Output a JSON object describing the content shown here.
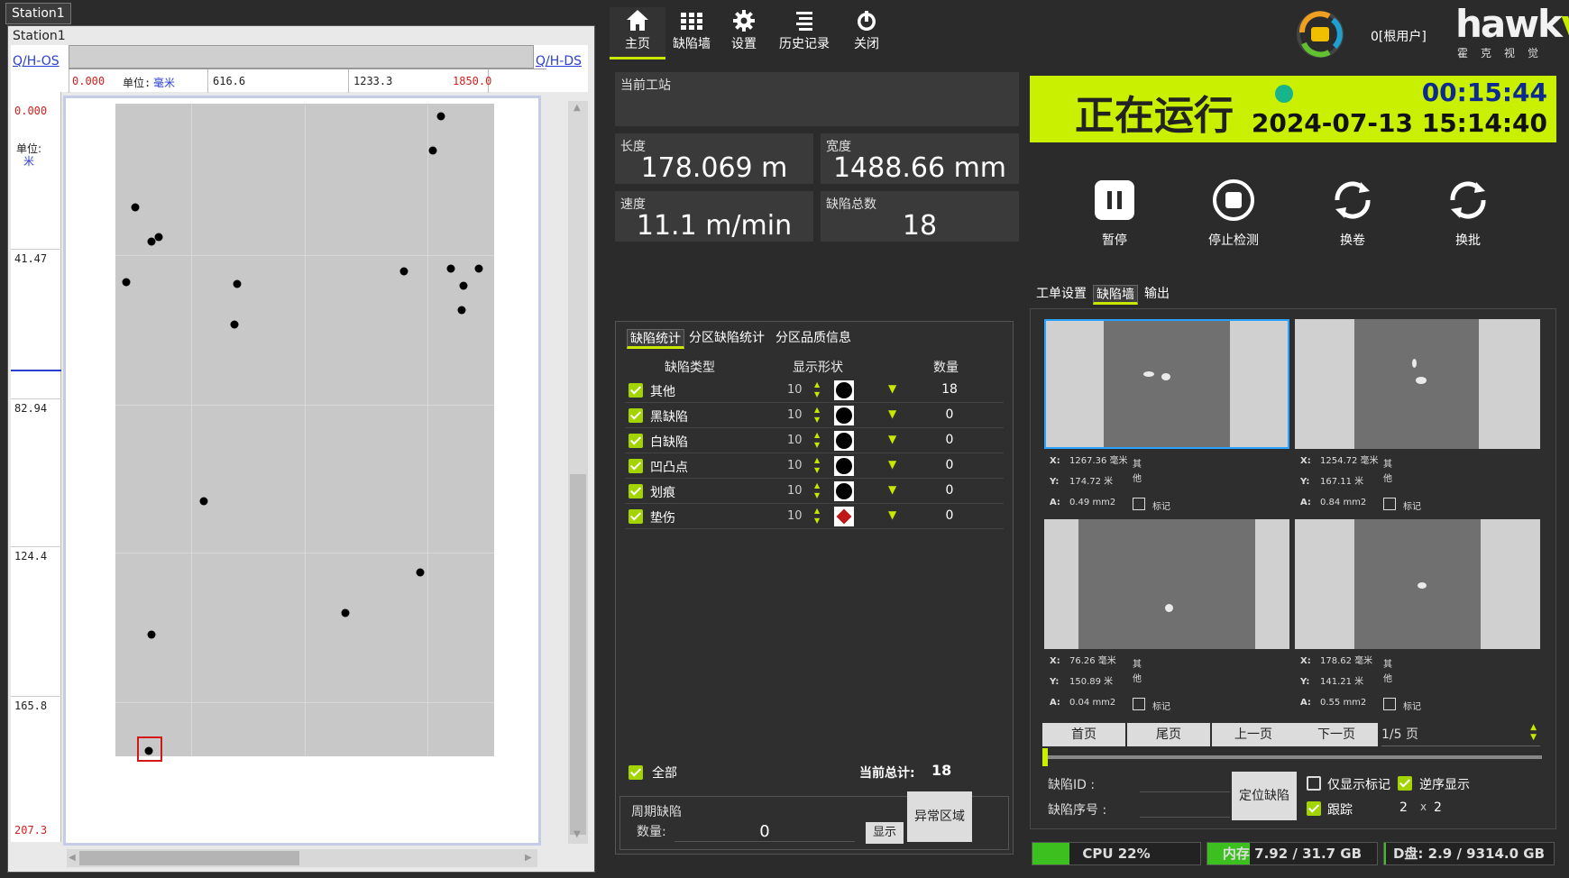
{
  "left": {
    "outer_tab": "Station1",
    "inner_tab": "Station1",
    "os_label": "Q/H-OS",
    "ds_label": "Q/H-DS",
    "x_ticks": [
      "0.000",
      "616.6",
      "1233.3",
      "1850.0"
    ],
    "x_unit_prefix": "单位:",
    "x_unit": "毫米",
    "y_ticks": [
      "0.000",
      "41.47",
      "82.94",
      "124.4",
      "165.8",
      "207.3"
    ],
    "y_unit_prefix": "单位:",
    "y_unit": "米"
  },
  "nav": [
    {
      "label": "主页",
      "icon": "home-icon"
    },
    {
      "label": "缺陷墙",
      "icon": "grid-icon"
    },
    {
      "label": "设置",
      "icon": "gear-icon"
    },
    {
      "label": "历史记录",
      "icon": "history-icon"
    },
    {
      "label": "关闭",
      "icon": "power-icon"
    }
  ],
  "user": "0[根用户]",
  "brand": {
    "name_a": "hawk",
    "name_b": "vis",
    "sub": "霍克视觉"
  },
  "info": {
    "station_caption": "当前工站",
    "length_caption": "长度",
    "length_value": "178.069 m",
    "width_caption": "宽度",
    "width_value": "1488.66 mm",
    "speed_caption": "速度",
    "speed_value": "11.1 m/min",
    "defects_caption": "缺陷总数",
    "defects_value": "18"
  },
  "stats": {
    "tabs": [
      "缺陷统计",
      "分区缺陷统计",
      "分区品质信息"
    ],
    "headers": [
      "缺陷类型",
      "显示形状",
      "数量"
    ],
    "rows": [
      {
        "name": "其他",
        "size": "10",
        "shape": "circle",
        "count": "18"
      },
      {
        "name": "黑缺陷",
        "size": "10",
        "shape": "circle",
        "count": "0"
      },
      {
        "name": "白缺陷",
        "size": "10",
        "shape": "circle",
        "count": "0"
      },
      {
        "name": "凹凸点",
        "size": "10",
        "shape": "circle",
        "count": "0"
      },
      {
        "name": "划痕",
        "size": "10",
        "shape": "circle",
        "count": "0"
      },
      {
        "name": "垫伤",
        "size": "10",
        "shape": "diamond",
        "count": "0"
      }
    ],
    "all_label": "全部",
    "total_label": "当前总计:",
    "total_value": "18",
    "periodic_title": "周期缺陷",
    "periodic_count_label": "数量:",
    "periodic_count": "0",
    "show_button": "显示",
    "abnormal_button": "异常区域"
  },
  "status": {
    "text": "正在运行",
    "timer": "00:15:44",
    "datetime": "2024-07-13 15:14:40",
    "led_color": "#18b48c",
    "banner_color": "#c8f000"
  },
  "controls": [
    {
      "label": "暂停",
      "icon": "pause-icon"
    },
    {
      "label": "停止检测",
      "icon": "stop-icon"
    },
    {
      "label": "换卷",
      "icon": "refresh-icon"
    },
    {
      "label": "换批",
      "icon": "refresh-icon"
    }
  ],
  "gallery": {
    "tabs": [
      "工单设置",
      "缺陷墙",
      "输出"
    ],
    "cards": [
      {
        "x": "1267.36 毫米",
        "y": "174.72 米",
        "a": "0.49 mm2",
        "type_a": "其",
        "type_b": "他",
        "mark": "标记"
      },
      {
        "x": "1254.72 毫米",
        "y": "167.11 米",
        "a": "0.84 mm2",
        "type_a": "其",
        "type_b": "他",
        "mark": "标记"
      },
      {
        "x": "76.26 毫米",
        "y": "150.89 米",
        "a": "0.04 mm2",
        "type_a": "其",
        "type_b": "他",
        "mark": "标记"
      },
      {
        "x": "178.62 毫米",
        "y": "141.21 米",
        "a": "0.55 mm2",
        "type_a": "其",
        "type_b": "他",
        "mark": "标记"
      }
    ],
    "meta_keys": {
      "x": "X:",
      "y": "Y:",
      "a": "A:"
    },
    "pager": {
      "first": "首页",
      "last": "尾页",
      "prev": "上一页",
      "next": "下一页",
      "page": "1/5 页"
    },
    "defect_id_label": "缺陷ID :",
    "defect_seq_label": "缺陷序号 :",
    "locate_button": "定位缺陷",
    "only_marked": "仅显示标记",
    "reverse": "逆序显示",
    "track": "跟踪",
    "grid_a": "2",
    "grid_x": "x",
    "grid_b": "2"
  },
  "resources": {
    "cpu": "CPU 22%",
    "cpu_pct": 22,
    "mem": "内存 7.92 / 31.7 GB",
    "mem_pct": 25,
    "disk": "D盘: 2.9 / 9314.0 GB",
    "disk_pct": 1
  }
}
